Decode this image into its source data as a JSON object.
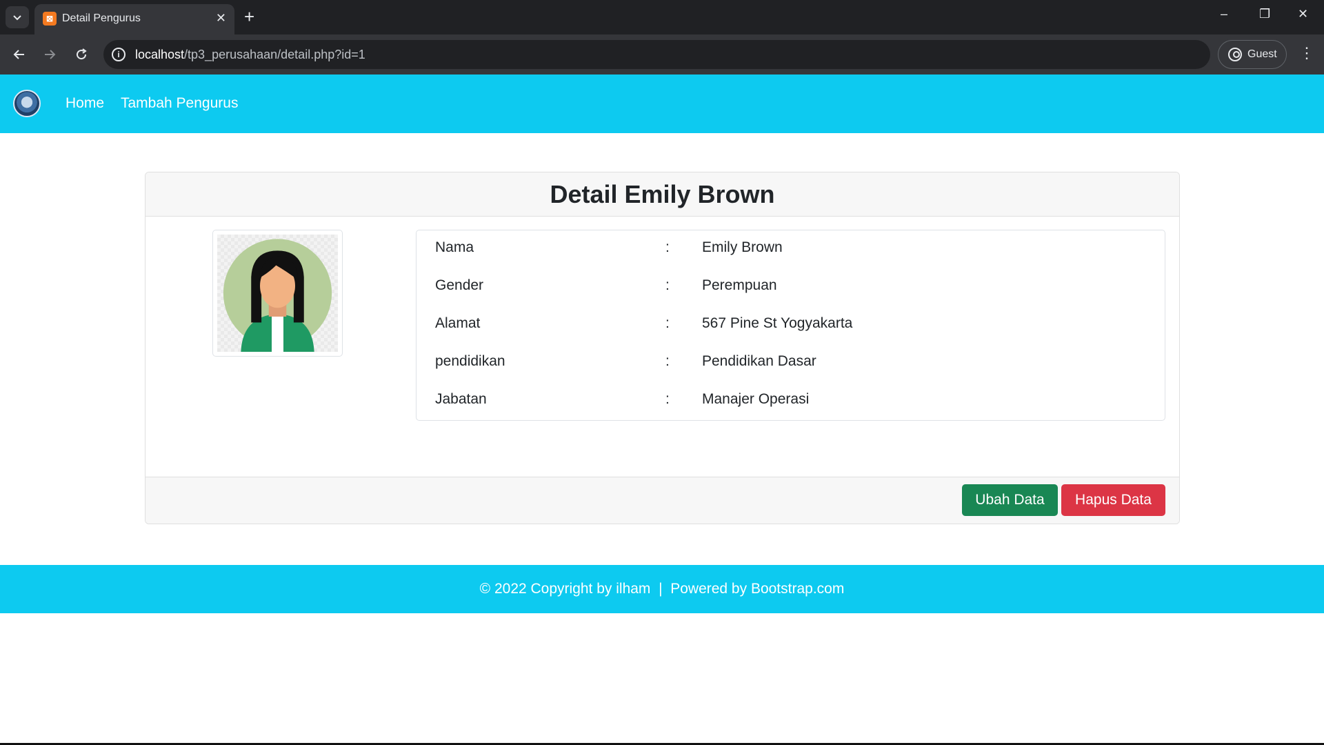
{
  "browser": {
    "tab_title": "Detail Pengurus",
    "tab_close": "✕",
    "new_tab": "+",
    "url_host": "localhost",
    "url_path": "/tp3_perusahaan/detail.php?id=1",
    "profile_label": "Guest",
    "window_controls": {
      "minimize": "–",
      "restore": "❐",
      "close": "✕"
    }
  },
  "navbar": {
    "links": [
      "Home",
      "Tambah Pengurus"
    ]
  },
  "card": {
    "title": "Detail Emily Brown",
    "rows": [
      {
        "label": "Nama",
        "sep": ":",
        "value": "Emily Brown"
      },
      {
        "label": "Gender",
        "sep": ":",
        "value": "Perempuan"
      },
      {
        "label": "Alamat",
        "sep": ":",
        "value": "567 Pine St Yogyakarta"
      },
      {
        "label": "pendidikan",
        "sep": ":",
        "value": "Pendidikan Dasar"
      },
      {
        "label": "Jabatan",
        "sep": ":",
        "value": "Manajer Operasi"
      }
    ],
    "buttons": {
      "edit": "Ubah Data",
      "delete": "Hapus Data"
    }
  },
  "footer": {
    "text": "© 2022 Copyright by ilham  |  Powered by Bootstrap.com"
  },
  "colors": {
    "navbar": "#0dcaf0",
    "edit_button": "#198754",
    "delete_button": "#dc3545"
  }
}
